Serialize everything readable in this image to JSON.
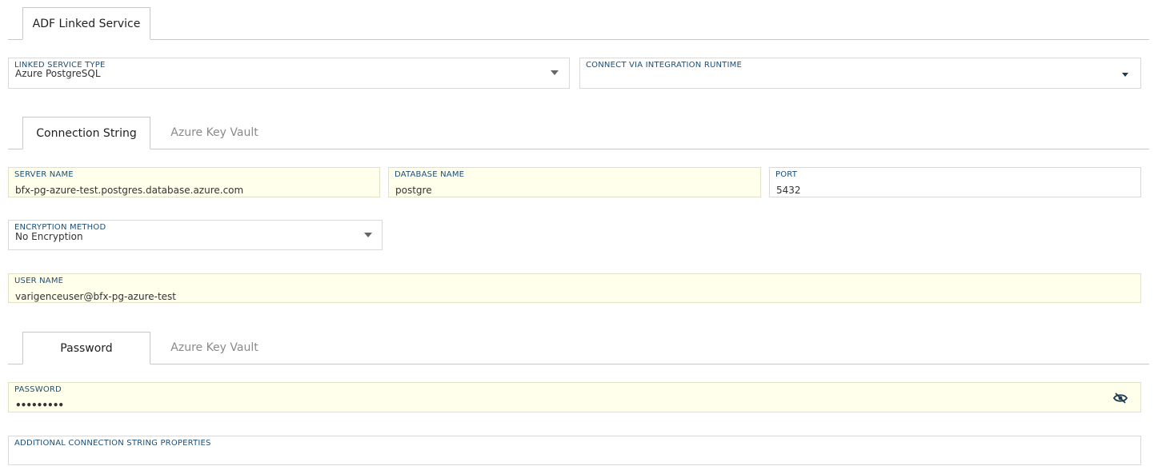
{
  "top_tabs": {
    "adf_linked_service": "ADF Linked Service"
  },
  "linked_service_type": {
    "label": "LINKED SERVICE TYPE",
    "value": "Azure PostgreSQL"
  },
  "integration_runtime": {
    "label": "CONNECT VIA INTEGRATION RUNTIME",
    "value": ""
  },
  "connection_tabs": {
    "connection_string": "Connection String",
    "azure_key_vault": "Azure Key Vault"
  },
  "server_name": {
    "label": "SERVER NAME",
    "value": "bfx-pg-azure-test.postgres.database.azure.com"
  },
  "database_name": {
    "label": "DATABASE NAME",
    "value": "postgre"
  },
  "port": {
    "label": "PORT",
    "value": "5432"
  },
  "encryption_method": {
    "label": "ENCRYPTION METHOD",
    "value": "No Encryption"
  },
  "user_name": {
    "label": "USER NAME",
    "value": "varigenceuser@bfx-pg-azure-test"
  },
  "password_tabs": {
    "password": "Password",
    "azure_key_vault": "Azure Key Vault"
  },
  "password": {
    "label": "PASSWORD",
    "value": "•••••••••",
    "toggle_icon": "eye-slash-icon"
  },
  "additional_properties": {
    "label": "ADDITIONAL CONNECTION STRING PROPERTIES",
    "value": ""
  },
  "colors": {
    "label": "#1c4e78",
    "filled_background": "#ffffeb",
    "border": "#d9d9d9"
  }
}
